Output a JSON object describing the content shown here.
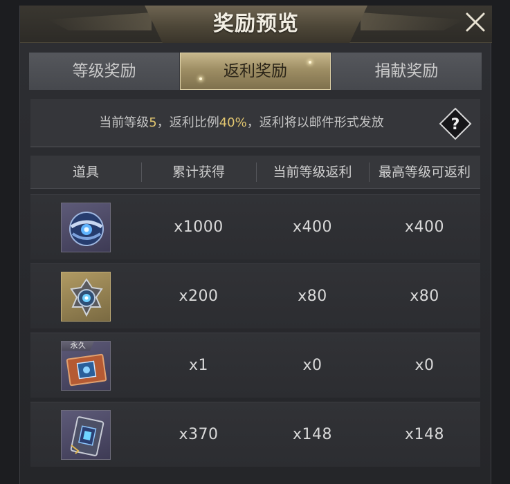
{
  "window": {
    "title": "奖励预览",
    "close_icon": "close-icon"
  },
  "tabs": [
    {
      "label": "等级奖励",
      "active": false
    },
    {
      "label": "返利奖励",
      "active": true
    },
    {
      "label": "捐献奖励",
      "active": false
    }
  ],
  "info": {
    "prefix": "当前等级",
    "level": "5",
    "middle": "，返利比例",
    "rate": "40%",
    "suffix": "，返利将以邮件形式发放",
    "help_icon": "question-icon",
    "highlight_color": "#e3c770"
  },
  "table": {
    "headers": [
      "道具",
      "累计获得",
      "当前等级返利",
      "最高等级可返利"
    ],
    "rows": [
      {
        "icon": "blue-orb-icon",
        "frame": "purple",
        "tag": "",
        "total": "x1000",
        "current": "x400",
        "max": "x400"
      },
      {
        "icon": "gear-core-icon",
        "frame": "gold",
        "tag": "",
        "total": "x200",
        "current": "x80",
        "max": "x80"
      },
      {
        "icon": "red-card-icon",
        "frame": "purple",
        "tag": "永久",
        "total": "x1",
        "current": "x0",
        "max": "x0"
      },
      {
        "icon": "tech-chip-icon",
        "frame": "purple",
        "tag": "",
        "total": "x370",
        "current": "x148",
        "max": "x148"
      }
    ]
  }
}
